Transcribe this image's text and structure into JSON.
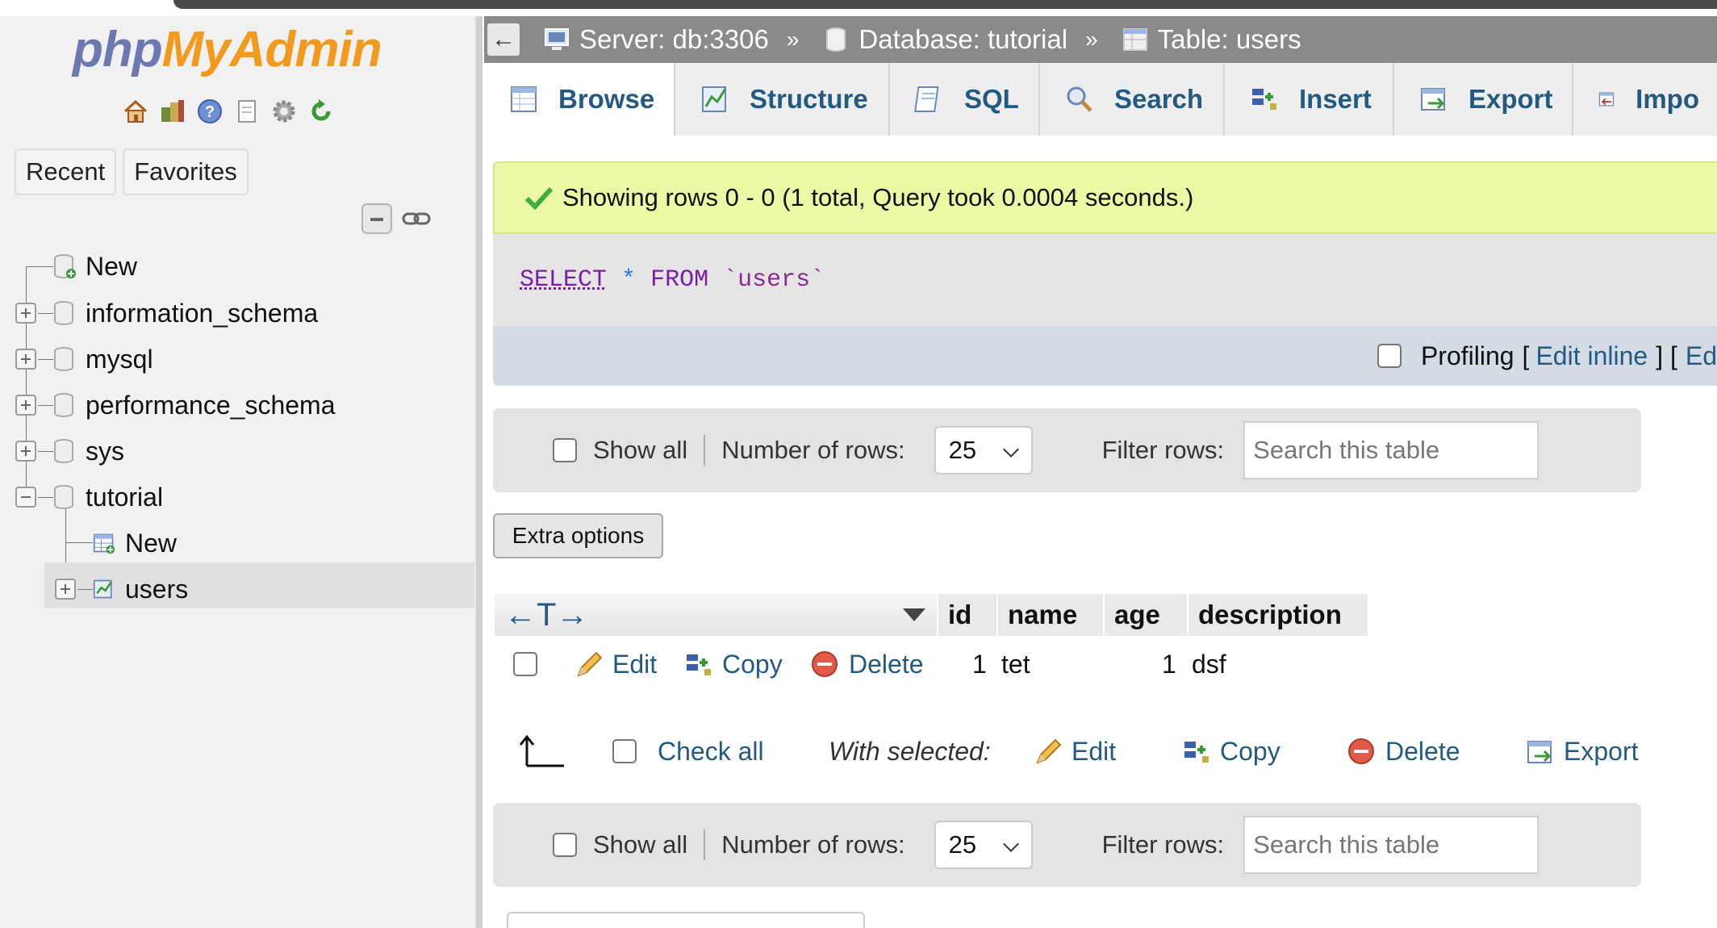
{
  "sidebar": {
    "logo_php": "php",
    "logo_rest": "MyAdmin",
    "quick_icons": [
      "home-icon",
      "database-icon",
      "help-icon",
      "document-icon",
      "gear-icon",
      "reload-icon"
    ],
    "tabs": [
      "Recent",
      "Favorites"
    ],
    "tree": [
      {
        "label": "New",
        "icon": "new-database-icon"
      },
      {
        "label": "information_schema",
        "icon": "database-icon"
      },
      {
        "label": "mysql",
        "icon": "database-icon"
      },
      {
        "label": "performance_schema",
        "icon": "database-icon"
      },
      {
        "label": "sys",
        "icon": "database-icon"
      },
      {
        "label": "tutorial",
        "icon": "database-icon"
      },
      {
        "label": "New",
        "icon": "new-table-icon"
      },
      {
        "label": "users",
        "icon": "table-icon"
      }
    ]
  },
  "breadcrumb": {
    "server": "Server: db:3306",
    "database": "Database: tutorial",
    "table": "Table: users",
    "separator": "»"
  },
  "tabs": [
    "Browse",
    "Structure",
    "SQL",
    "Search",
    "Insert",
    "Export",
    "Impo"
  ],
  "message": "Showing rows 0 - 0 (1 total, Query took 0.0004 seconds.)",
  "sql": {
    "select": "SELECT",
    "star": "*",
    "from": "FROM",
    "table": "`users`"
  },
  "profiling": {
    "label": "Profiling",
    "open_bracket": "[",
    "edit_inline": "Edit inline",
    "close_bracket": "] [",
    "edit": "Ed"
  },
  "navbar": {
    "show_all": "Show all",
    "rows_label": "Number of rows:",
    "rows_value": "25",
    "filter_label": "Filter rows:",
    "filter_placeholder": "Search this table"
  },
  "extra_options": "Extra options",
  "table": {
    "columns": [
      "id",
      "name",
      "age",
      "description"
    ],
    "row": {
      "id": "1",
      "name": "tet",
      "age": "1",
      "description": "dsf"
    },
    "actions": [
      "Edit",
      "Copy",
      "Delete"
    ]
  },
  "with_selected": {
    "check_all": "Check all",
    "label": "With selected:",
    "edit": "Edit",
    "copy": "Copy",
    "delete": "Delete",
    "export": "Export"
  },
  "colors": {
    "link": "#235a81",
    "message_bg": "#ebf8a4",
    "breadcrumb_bg": "#8a8a8a",
    "logo_php": "#6c78af",
    "logo_rest": "#f29a1e"
  }
}
